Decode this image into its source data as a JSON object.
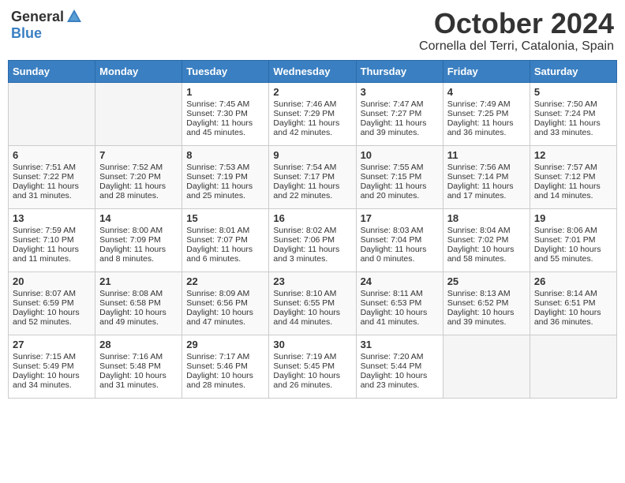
{
  "logo": {
    "general": "General",
    "blue": "Blue"
  },
  "title": "October 2024",
  "location": "Cornella del Terri, Catalonia, Spain",
  "days_header": [
    "Sunday",
    "Monday",
    "Tuesday",
    "Wednesday",
    "Thursday",
    "Friday",
    "Saturday"
  ],
  "weeks": [
    [
      {
        "day": "",
        "sunrise": "",
        "sunset": "",
        "daylight": ""
      },
      {
        "day": "",
        "sunrise": "",
        "sunset": "",
        "daylight": ""
      },
      {
        "day": "1",
        "sunrise": "Sunrise: 7:45 AM",
        "sunset": "Sunset: 7:30 PM",
        "daylight": "Daylight: 11 hours and 45 minutes."
      },
      {
        "day": "2",
        "sunrise": "Sunrise: 7:46 AM",
        "sunset": "Sunset: 7:29 PM",
        "daylight": "Daylight: 11 hours and 42 minutes."
      },
      {
        "day": "3",
        "sunrise": "Sunrise: 7:47 AM",
        "sunset": "Sunset: 7:27 PM",
        "daylight": "Daylight: 11 hours and 39 minutes."
      },
      {
        "day": "4",
        "sunrise": "Sunrise: 7:49 AM",
        "sunset": "Sunset: 7:25 PM",
        "daylight": "Daylight: 11 hours and 36 minutes."
      },
      {
        "day": "5",
        "sunrise": "Sunrise: 7:50 AM",
        "sunset": "Sunset: 7:24 PM",
        "daylight": "Daylight: 11 hours and 33 minutes."
      }
    ],
    [
      {
        "day": "6",
        "sunrise": "Sunrise: 7:51 AM",
        "sunset": "Sunset: 7:22 PM",
        "daylight": "Daylight: 11 hours and 31 minutes."
      },
      {
        "day": "7",
        "sunrise": "Sunrise: 7:52 AM",
        "sunset": "Sunset: 7:20 PM",
        "daylight": "Daylight: 11 hours and 28 minutes."
      },
      {
        "day": "8",
        "sunrise": "Sunrise: 7:53 AM",
        "sunset": "Sunset: 7:19 PM",
        "daylight": "Daylight: 11 hours and 25 minutes."
      },
      {
        "day": "9",
        "sunrise": "Sunrise: 7:54 AM",
        "sunset": "Sunset: 7:17 PM",
        "daylight": "Daylight: 11 hours and 22 minutes."
      },
      {
        "day": "10",
        "sunrise": "Sunrise: 7:55 AM",
        "sunset": "Sunset: 7:15 PM",
        "daylight": "Daylight: 11 hours and 20 minutes."
      },
      {
        "day": "11",
        "sunrise": "Sunrise: 7:56 AM",
        "sunset": "Sunset: 7:14 PM",
        "daylight": "Daylight: 11 hours and 17 minutes."
      },
      {
        "day": "12",
        "sunrise": "Sunrise: 7:57 AM",
        "sunset": "Sunset: 7:12 PM",
        "daylight": "Daylight: 11 hours and 14 minutes."
      }
    ],
    [
      {
        "day": "13",
        "sunrise": "Sunrise: 7:59 AM",
        "sunset": "Sunset: 7:10 PM",
        "daylight": "Daylight: 11 hours and 11 minutes."
      },
      {
        "day": "14",
        "sunrise": "Sunrise: 8:00 AM",
        "sunset": "Sunset: 7:09 PM",
        "daylight": "Daylight: 11 hours and 8 minutes."
      },
      {
        "day": "15",
        "sunrise": "Sunrise: 8:01 AM",
        "sunset": "Sunset: 7:07 PM",
        "daylight": "Daylight: 11 hours and 6 minutes."
      },
      {
        "day": "16",
        "sunrise": "Sunrise: 8:02 AM",
        "sunset": "Sunset: 7:06 PM",
        "daylight": "Daylight: 11 hours and 3 minutes."
      },
      {
        "day": "17",
        "sunrise": "Sunrise: 8:03 AM",
        "sunset": "Sunset: 7:04 PM",
        "daylight": "Daylight: 11 hours and 0 minutes."
      },
      {
        "day": "18",
        "sunrise": "Sunrise: 8:04 AM",
        "sunset": "Sunset: 7:02 PM",
        "daylight": "Daylight: 10 hours and 58 minutes."
      },
      {
        "day": "19",
        "sunrise": "Sunrise: 8:06 AM",
        "sunset": "Sunset: 7:01 PM",
        "daylight": "Daylight: 10 hours and 55 minutes."
      }
    ],
    [
      {
        "day": "20",
        "sunrise": "Sunrise: 8:07 AM",
        "sunset": "Sunset: 6:59 PM",
        "daylight": "Daylight: 10 hours and 52 minutes."
      },
      {
        "day": "21",
        "sunrise": "Sunrise: 8:08 AM",
        "sunset": "Sunset: 6:58 PM",
        "daylight": "Daylight: 10 hours and 49 minutes."
      },
      {
        "day": "22",
        "sunrise": "Sunrise: 8:09 AM",
        "sunset": "Sunset: 6:56 PM",
        "daylight": "Daylight: 10 hours and 47 minutes."
      },
      {
        "day": "23",
        "sunrise": "Sunrise: 8:10 AM",
        "sunset": "Sunset: 6:55 PM",
        "daylight": "Daylight: 10 hours and 44 minutes."
      },
      {
        "day": "24",
        "sunrise": "Sunrise: 8:11 AM",
        "sunset": "Sunset: 6:53 PM",
        "daylight": "Daylight: 10 hours and 41 minutes."
      },
      {
        "day": "25",
        "sunrise": "Sunrise: 8:13 AM",
        "sunset": "Sunset: 6:52 PM",
        "daylight": "Daylight: 10 hours and 39 minutes."
      },
      {
        "day": "26",
        "sunrise": "Sunrise: 8:14 AM",
        "sunset": "Sunset: 6:51 PM",
        "daylight": "Daylight: 10 hours and 36 minutes."
      }
    ],
    [
      {
        "day": "27",
        "sunrise": "Sunrise: 7:15 AM",
        "sunset": "Sunset: 5:49 PM",
        "daylight": "Daylight: 10 hours and 34 minutes."
      },
      {
        "day": "28",
        "sunrise": "Sunrise: 7:16 AM",
        "sunset": "Sunset: 5:48 PM",
        "daylight": "Daylight: 10 hours and 31 minutes."
      },
      {
        "day": "29",
        "sunrise": "Sunrise: 7:17 AM",
        "sunset": "Sunset: 5:46 PM",
        "daylight": "Daylight: 10 hours and 28 minutes."
      },
      {
        "day": "30",
        "sunrise": "Sunrise: 7:19 AM",
        "sunset": "Sunset: 5:45 PM",
        "daylight": "Daylight: 10 hours and 26 minutes."
      },
      {
        "day": "31",
        "sunrise": "Sunrise: 7:20 AM",
        "sunset": "Sunset: 5:44 PM",
        "daylight": "Daylight: 10 hours and 23 minutes."
      },
      {
        "day": "",
        "sunrise": "",
        "sunset": "",
        "daylight": ""
      },
      {
        "day": "",
        "sunrise": "",
        "sunset": "",
        "daylight": ""
      }
    ]
  ]
}
